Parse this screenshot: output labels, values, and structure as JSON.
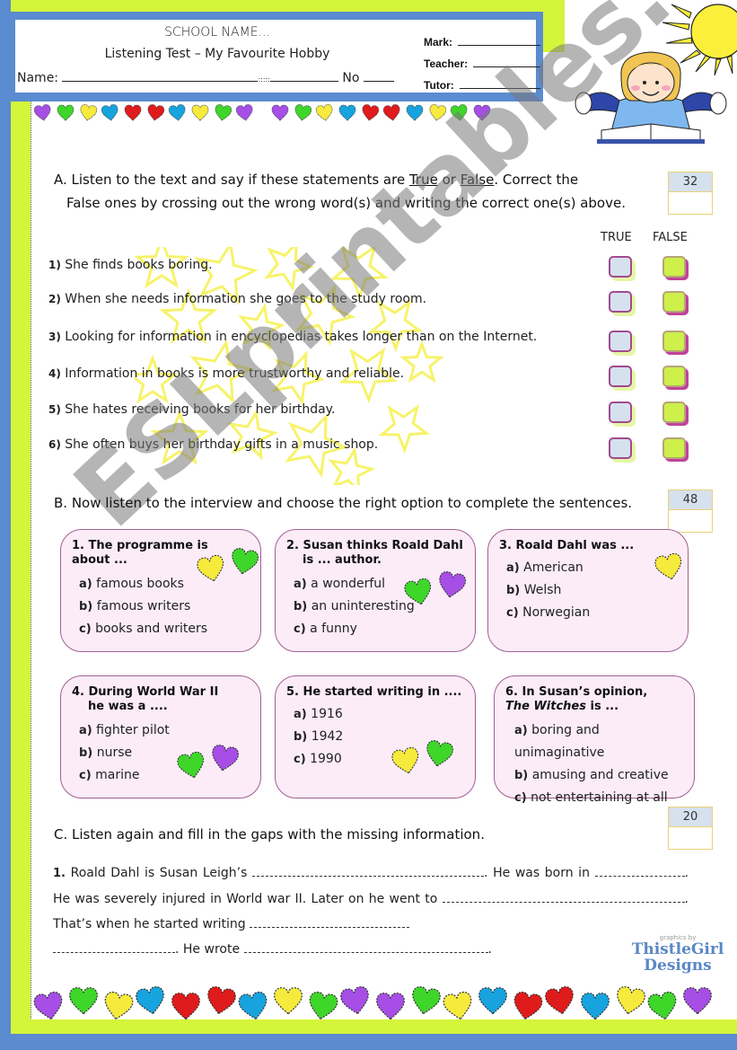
{
  "header": {
    "school_name": "SCHOOL NAME...",
    "test_title": "Listening Test – My Favourite Hobby",
    "name_label": "Name:",
    "separator": ":::::",
    "number_label": "No",
    "mark_label": "Mark:",
    "teacher_label": "Teacher:",
    "tutor_label": "Tutor:"
  },
  "colors": {
    "frame_blue": "#5b8bd1",
    "frame_lime": "#d4f53a",
    "card_bg": "#fbecf8",
    "card_border": "#a15f93",
    "heart_colors": [
      "#a64ee6",
      "#3fd62a",
      "#f6ea3c",
      "#17a3de",
      "#e01b1b"
    ]
  },
  "hearts_top": [
    "purple",
    "green",
    "yellow",
    "blue",
    "red",
    "red",
    "blue",
    "yellow",
    "green",
    "purple",
    "purple",
    "green",
    "yellow",
    "blue",
    "red",
    "red",
    "blue",
    "yellow",
    "green",
    "purple"
  ],
  "hearts_bottom": [
    "purple",
    "green",
    "yellow",
    "blue",
    "red",
    "red",
    "blue",
    "yellow",
    "green",
    "purple",
    "purple",
    "green",
    "yellow",
    "blue",
    "red",
    "red",
    "blue",
    "yellow",
    "green",
    "purple"
  ],
  "section_a": {
    "title_part1": "A. Listen to the text and say if these statements are ",
    "true_word": "True",
    "or_word": " or ",
    "false_word": "False",
    "title_part2": ". Correct the",
    "title_line2": "False ones by crossing out the wrong word(s) and writing the correct one(s) above.",
    "score": "32",
    "true_header": "TRUE",
    "false_header": "FALSE",
    "statements": [
      {
        "num": "1)",
        "text": " She finds books boring."
      },
      {
        "num": "2)",
        "text": " When she needs information she goes to the study room."
      },
      {
        "num": "3)",
        "text": " Looking for information in encyclopedias takes longer than on the Internet."
      },
      {
        "num": "4)",
        "text": " Information in books is more trustworthy and reliable."
      },
      {
        "num": "5)",
        "text": " She hates receiving books for her birthday."
      },
      {
        "num": "6)",
        "text": " She often buys her birthday gifts in a music shop."
      }
    ]
  },
  "section_b": {
    "title": "B. Now listen to the interview and choose the right option to complete the sentences.",
    "score": "48",
    "questions": [
      {
        "q_line1": "1. The programme is",
        "q_line2": "about ...",
        "options": [
          {
            "l": "a)",
            "t": " famous books"
          },
          {
            "l": "b)",
            "t": " famous writers"
          },
          {
            "l": "c)",
            "t": " books and writers"
          }
        ]
      },
      {
        "q_line1": "2. Susan thinks Roald Dahl",
        "q_line2": "is ... author.",
        "options": [
          {
            "l": "a)",
            "t": " a wonderful"
          },
          {
            "l": "b)",
            "t": " an uninteresting"
          },
          {
            "l": "c)",
            "t": " a funny"
          }
        ]
      },
      {
        "q_line1": "3. Roald Dahl was ...",
        "q_line2": "",
        "options": [
          {
            "l": "a)",
            "t": " American"
          },
          {
            "l": "b)",
            "t": " Welsh"
          },
          {
            "l": "c)",
            "t": " Norwegian"
          }
        ]
      },
      {
        "q_line1": "4. During World War II",
        "q_line2": "he was a ....",
        "options": [
          {
            "l": "a)",
            "t": " fighter pilot"
          },
          {
            "l": "b)",
            "t": " nurse"
          },
          {
            "l": "c)",
            "t": " marine"
          }
        ]
      },
      {
        "q_line1": "5. He started writing in ....",
        "q_line2": "",
        "options": [
          {
            "l": "a)",
            "t": " 1916"
          },
          {
            "l": "b)",
            "t": " 1942"
          },
          {
            "l": "c)",
            "t": " 1990"
          }
        ]
      },
      {
        "q_line1": "6.  In  Susan’s  opinion,",
        "q_line2_italic": "The Witches",
        "q_line2": " is ...",
        "options": [
          {
            "l": "a)",
            "t": " boring and unimaginative"
          },
          {
            "l": "b)",
            "t": " amusing and creative"
          },
          {
            "l": "c)",
            "t": " not entertaining at all"
          }
        ]
      }
    ]
  },
  "section_c": {
    "title": "C. Listen again and fill in the gaps with the missing information.",
    "score": "20",
    "num": "1.",
    "t1": " Roald Dahl is Susan Leigh’s ",
    "t2": ". He was born in ",
    "t3": ". He was severely injured in World war II. Later on he went to ",
    "t4": ". That’s when he started writing ",
    "t5": ". He wrote ",
    "t6": "."
  },
  "watermark": "ESLprintables.com",
  "logo": {
    "by": "graphics by",
    "line1": "ThistleGirl",
    "line2": "Designs"
  }
}
